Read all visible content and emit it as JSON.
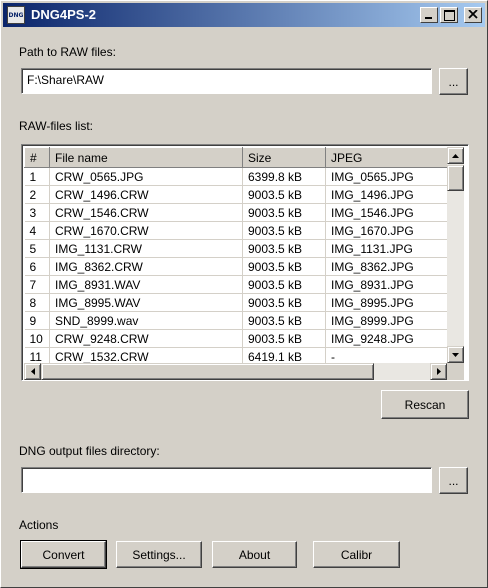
{
  "window": {
    "title": "DNG4PS-2",
    "icon": "dng-app-icon",
    "icon_text": "DNG"
  },
  "raw_path": {
    "label": "Path to RAW files:",
    "value": "F:\\Share\\RAW",
    "browse_label": "..."
  },
  "raw_list": {
    "label": "RAW-files list:",
    "columns": [
      "#",
      "File name",
      "Size",
      "JPEG"
    ],
    "rows": [
      [
        "1",
        "CRW_0565.JPG",
        "6399.8 kB",
        "IMG_0565.JPG"
      ],
      [
        "2",
        "CRW_1496.CRW",
        "9003.5 kB",
        "IMG_1496.JPG"
      ],
      [
        "3",
        "CRW_1546.CRW",
        "9003.5 kB",
        "IMG_1546.JPG"
      ],
      [
        "4",
        "CRW_1670.CRW",
        "9003.5 kB",
        "IMG_1670.JPG"
      ],
      [
        "5",
        "IMG_1131.CRW",
        "9003.5 kB",
        "IMG_1131.JPG"
      ],
      [
        "6",
        "IMG_8362.CRW",
        "9003.5 kB",
        "IMG_8362.JPG"
      ],
      [
        "7",
        "IMG_8931.WAV",
        "9003.5 kB",
        "IMG_8931.JPG"
      ],
      [
        "8",
        "IMG_8995.WAV",
        "9003.5 kB",
        "IMG_8995.JPG"
      ],
      [
        "9",
        "SND_8999.wav",
        "9003.5 kB",
        "IMG_8999.JPG"
      ],
      [
        "10",
        "CRW_9248.CRW",
        "9003.5 kB",
        "IMG_9248.JPG"
      ],
      [
        "11",
        "CRW_1532.CRW",
        "6419.1 kB",
        "-"
      ]
    ]
  },
  "rescan_label": "Rescan",
  "dng_output": {
    "label": "DNG output files directory:",
    "value": "",
    "browse_label": "..."
  },
  "actions": {
    "label": "Actions",
    "convert": "Convert",
    "settings": "Settings...",
    "about": "About",
    "calibr": "Calibr"
  },
  "colors": {
    "titlebar_start": "#0a246a",
    "titlebar_end": "#a6caf0",
    "face": "#d4d0c8"
  }
}
